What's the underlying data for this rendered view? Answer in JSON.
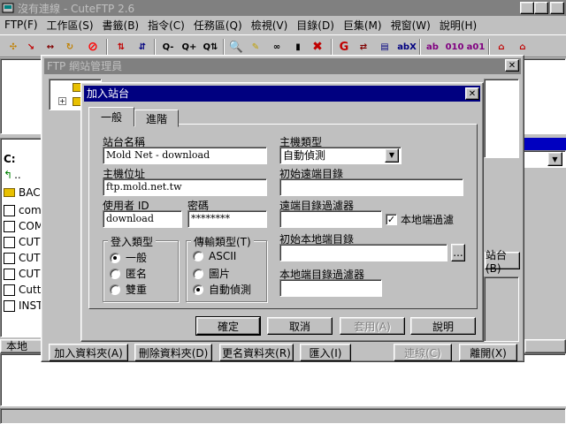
{
  "app": {
    "title": "沒有連線 - CuteFTP 2.6"
  },
  "menu": [
    "FTP(F)",
    "工作區(S)",
    "書籤(B)",
    "指令(C)",
    "任務區(Q)",
    "檢視(V)",
    "目錄(D)",
    "巨集(M)",
    "視窗(W)",
    "說明(H)"
  ],
  "toolbar": {
    "icons": [
      "connect-icon",
      "quick-connect-icon",
      "disconnect-icon",
      "reconnect-icon",
      "stop-icon",
      "upload-icon",
      "download-icon",
      "queue-icon",
      "queue-add-icon",
      "queue-transfer-icon",
      "find-icon",
      "edit-icon",
      "binoculars-icon",
      "delete-icon",
      "remove-icon",
      "refresh-icon",
      "view-icon",
      "rename-icon",
      "abc-icon",
      "ascii-icon",
      "binary-icon",
      "auto-icon",
      "site-icon",
      "home-icon"
    ]
  },
  "local": {
    "drive": "C:",
    "up": "..",
    "files": [
      {
        "name": "BAC",
        "type": "folder"
      },
      {
        "name": "com",
        "type": "file"
      },
      {
        "name": "COM",
        "type": "file"
      },
      {
        "name": "CUT",
        "type": "file"
      },
      {
        "name": "CUT",
        "type": "file"
      },
      {
        "name": "CUT",
        "type": "file"
      },
      {
        "name": "Cuttf",
        "type": "file"
      },
      {
        "name": "INST",
        "type": "file"
      }
    ],
    "header": "本地"
  },
  "site_manager": {
    "title": "FTP 網站管理員",
    "side_button": "站台(B)",
    "buttons": {
      "add_folder": "加入資料夾(A)",
      "delete_folder": "刪除資料夾(D)",
      "rename_folder": "更名資料夾(R)",
      "import": "匯入(I)",
      "connect": "連線(C)",
      "exit": "離開(X)"
    }
  },
  "add_site": {
    "title": "加入站台",
    "tabs": [
      "一般",
      "進階"
    ],
    "site_name_label": "站台名稱",
    "site_name": "Mold Net - download",
    "host_label": "主機位址",
    "host": "ftp.mold.net.tw",
    "user_label": "使用者 ID",
    "user": "download",
    "password_label": "密碼",
    "password": "********",
    "login_group": "登入類型",
    "login_options": [
      "一般",
      "匿名",
      "雙重"
    ],
    "login_selected": 0,
    "transfer_group": "傳輸類型(T)",
    "transfer_options": [
      "ASCII",
      "圖片",
      "自動偵測"
    ],
    "transfer_selected": 2,
    "host_type_label": "主機類型",
    "host_type": "自動偵測",
    "remote_dir_label": "初始遠端目錄",
    "remote_dir": "",
    "remote_filter_label": "遠端目錄過濾器",
    "remote_filter": "",
    "local_filter_check_label": "本地端過濾",
    "local_filter_checked": true,
    "local_dir_label": "初始本地端目錄",
    "local_dir": "",
    "browse_label": "...",
    "local_filter_label": "本地端目錄過濾器",
    "local_filter": "",
    "ok": "確定",
    "cancel": "取消",
    "apply": "套用(A)",
    "help": "說明"
  }
}
